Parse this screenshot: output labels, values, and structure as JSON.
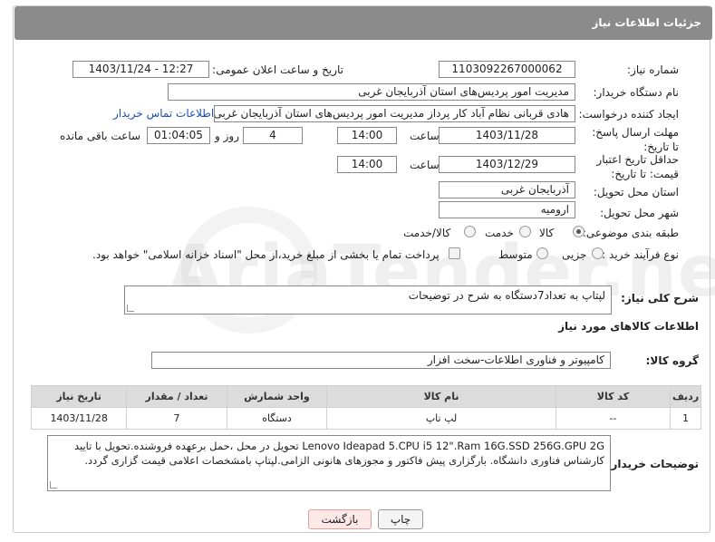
{
  "header": {
    "title": "جزئیات اطلاعات نیاز"
  },
  "labels": {
    "need_number": "شماره نیاز:",
    "announce_datetime": "تاریخ و ساعت اعلان عمومی:",
    "buyer_org": "نام دستگاه خریدار:",
    "requester": "ایجاد کننده درخواست:",
    "reply_deadline": "مهلت ارسال پاسخ: تا تاریخ:",
    "price_validity": "حداقل تاریخ اعتبار قیمت: تا تاریخ:",
    "delivery_province": "استان محل تحویل:",
    "delivery_city": "شهر محل تحویل:",
    "category": "طبقه بندی موضوعی:",
    "purchase_type": "نوع فرآیند خرید :",
    "hour": "ساعت",
    "days_and": "روز و",
    "hours_left": "ساعت باقی مانده",
    "general_desc": "شرح کلی نیاز:",
    "goods_info": "اطلاعات کالاهای مورد نیاز",
    "goods_group": "گروه کالا:",
    "buyer_notes": "توضیحات خریدار:"
  },
  "fields": {
    "need_number": "1103092267000062",
    "announce_datetime": "1403/11/24 - 12:27",
    "buyer_org": "مدیریت امور پردیس‌های استان آذربایجان غربی",
    "requester": "هادی قربانی نظام آباد کار پرداز مدیریت امور پردیس‌های استان آذربایجان غربی",
    "contact_link": "اطلاعات تماس خریدار",
    "reply_date": "1403/11/28",
    "reply_time": "14:00",
    "days": "4",
    "remaining": "01:04:05",
    "validity_date": "1403/12/29",
    "validity_time": "14:00",
    "province": "آذربایجان غربی",
    "city": "ارومیه",
    "general_desc": "لپتاپ به تعداد7دستگاه به شرح در توضیحات",
    "goods_group": "کامپیوتر و فناوری اطلاعات-سخت افزار",
    "buyer_notes": "Lenovo Ideapad 5.CPU    i5 12\".Ram    16G.SSD      256G.GPU      2G  تحویل در محل ،حمل برعهده فروشنده.تحویل با تایید کارشناس فناوری دانشگاه. بارگزاری پیش فاکتور و  مجوزهای هانونی الزامی.لپتاپ بامشخصات اعلامی قیمت گزاری گردد."
  },
  "category_options": [
    {
      "label": "کالا",
      "selected": true
    },
    {
      "label": "خدمت",
      "selected": false
    },
    {
      "label": "کالا/خدمت",
      "selected": false
    }
  ],
  "purchase_options": [
    {
      "label": "جزیی",
      "selected": false
    },
    {
      "label": "متوسط",
      "selected": false
    }
  ],
  "payment_note": "پرداخت تمام یا بخشی از مبلغ خرید،از محل \"اسناد خزانه اسلامی\" خواهد بود.",
  "table": {
    "headers": [
      "ردیف",
      "کد کالا",
      "نام کالا",
      "واحد شمارش",
      "تعداد / مقدار",
      "تاریخ نیاز"
    ],
    "rows": [
      [
        "1",
        "--",
        "لپ تاپ",
        "دستگاه",
        "7",
        "1403/11/28"
      ]
    ]
  },
  "buttons": {
    "print": "چاپ",
    "back": "بازگشت"
  },
  "watermark": "AriaTender.net"
}
